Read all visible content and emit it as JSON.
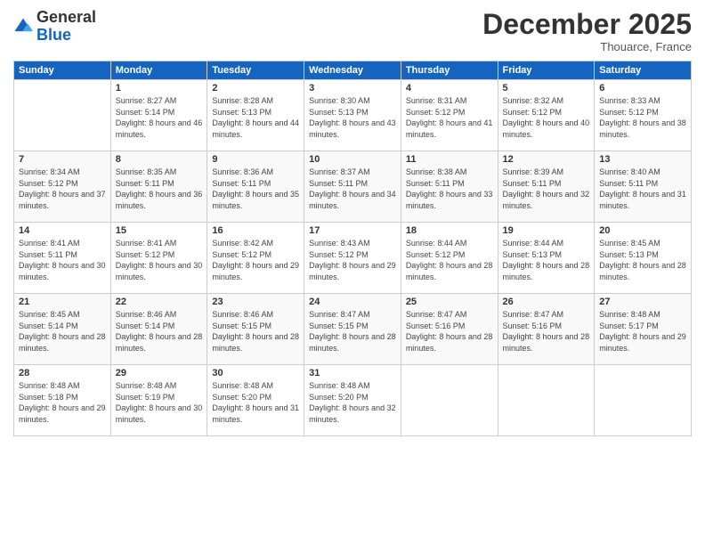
{
  "logo": {
    "general": "General",
    "blue": "Blue"
  },
  "header": {
    "month": "December 2025",
    "location": "Thouarce, France"
  },
  "weekdays": [
    "Sunday",
    "Monday",
    "Tuesday",
    "Wednesday",
    "Thursday",
    "Friday",
    "Saturday"
  ],
  "weeks": [
    [
      {
        "day": "",
        "sunrise": "",
        "sunset": "",
        "daylight": ""
      },
      {
        "day": "1",
        "sunrise": "Sunrise: 8:27 AM",
        "sunset": "Sunset: 5:14 PM",
        "daylight": "Daylight: 8 hours and 46 minutes."
      },
      {
        "day": "2",
        "sunrise": "Sunrise: 8:28 AM",
        "sunset": "Sunset: 5:13 PM",
        "daylight": "Daylight: 8 hours and 44 minutes."
      },
      {
        "day": "3",
        "sunrise": "Sunrise: 8:30 AM",
        "sunset": "Sunset: 5:13 PM",
        "daylight": "Daylight: 8 hours and 43 minutes."
      },
      {
        "day": "4",
        "sunrise": "Sunrise: 8:31 AM",
        "sunset": "Sunset: 5:12 PM",
        "daylight": "Daylight: 8 hours and 41 minutes."
      },
      {
        "day": "5",
        "sunrise": "Sunrise: 8:32 AM",
        "sunset": "Sunset: 5:12 PM",
        "daylight": "Daylight: 8 hours and 40 minutes."
      },
      {
        "day": "6",
        "sunrise": "Sunrise: 8:33 AM",
        "sunset": "Sunset: 5:12 PM",
        "daylight": "Daylight: 8 hours and 38 minutes."
      }
    ],
    [
      {
        "day": "7",
        "sunrise": "Sunrise: 8:34 AM",
        "sunset": "Sunset: 5:12 PM",
        "daylight": "Daylight: 8 hours and 37 minutes."
      },
      {
        "day": "8",
        "sunrise": "Sunrise: 8:35 AM",
        "sunset": "Sunset: 5:11 PM",
        "daylight": "Daylight: 8 hours and 36 minutes."
      },
      {
        "day": "9",
        "sunrise": "Sunrise: 8:36 AM",
        "sunset": "Sunset: 5:11 PM",
        "daylight": "Daylight: 8 hours and 35 minutes."
      },
      {
        "day": "10",
        "sunrise": "Sunrise: 8:37 AM",
        "sunset": "Sunset: 5:11 PM",
        "daylight": "Daylight: 8 hours and 34 minutes."
      },
      {
        "day": "11",
        "sunrise": "Sunrise: 8:38 AM",
        "sunset": "Sunset: 5:11 PM",
        "daylight": "Daylight: 8 hours and 33 minutes."
      },
      {
        "day": "12",
        "sunrise": "Sunrise: 8:39 AM",
        "sunset": "Sunset: 5:11 PM",
        "daylight": "Daylight: 8 hours and 32 minutes."
      },
      {
        "day": "13",
        "sunrise": "Sunrise: 8:40 AM",
        "sunset": "Sunset: 5:11 PM",
        "daylight": "Daylight: 8 hours and 31 minutes."
      }
    ],
    [
      {
        "day": "14",
        "sunrise": "Sunrise: 8:41 AM",
        "sunset": "Sunset: 5:11 PM",
        "daylight": "Daylight: 8 hours and 30 minutes."
      },
      {
        "day": "15",
        "sunrise": "Sunrise: 8:41 AM",
        "sunset": "Sunset: 5:12 PM",
        "daylight": "Daylight: 8 hours and 30 minutes."
      },
      {
        "day": "16",
        "sunrise": "Sunrise: 8:42 AM",
        "sunset": "Sunset: 5:12 PM",
        "daylight": "Daylight: 8 hours and 29 minutes."
      },
      {
        "day": "17",
        "sunrise": "Sunrise: 8:43 AM",
        "sunset": "Sunset: 5:12 PM",
        "daylight": "Daylight: 8 hours and 29 minutes."
      },
      {
        "day": "18",
        "sunrise": "Sunrise: 8:44 AM",
        "sunset": "Sunset: 5:12 PM",
        "daylight": "Daylight: 8 hours and 28 minutes."
      },
      {
        "day": "19",
        "sunrise": "Sunrise: 8:44 AM",
        "sunset": "Sunset: 5:13 PM",
        "daylight": "Daylight: 8 hours and 28 minutes."
      },
      {
        "day": "20",
        "sunrise": "Sunrise: 8:45 AM",
        "sunset": "Sunset: 5:13 PM",
        "daylight": "Daylight: 8 hours and 28 minutes."
      }
    ],
    [
      {
        "day": "21",
        "sunrise": "Sunrise: 8:45 AM",
        "sunset": "Sunset: 5:14 PM",
        "daylight": "Daylight: 8 hours and 28 minutes."
      },
      {
        "day": "22",
        "sunrise": "Sunrise: 8:46 AM",
        "sunset": "Sunset: 5:14 PM",
        "daylight": "Daylight: 8 hours and 28 minutes."
      },
      {
        "day": "23",
        "sunrise": "Sunrise: 8:46 AM",
        "sunset": "Sunset: 5:15 PM",
        "daylight": "Daylight: 8 hours and 28 minutes."
      },
      {
        "day": "24",
        "sunrise": "Sunrise: 8:47 AM",
        "sunset": "Sunset: 5:15 PM",
        "daylight": "Daylight: 8 hours and 28 minutes."
      },
      {
        "day": "25",
        "sunrise": "Sunrise: 8:47 AM",
        "sunset": "Sunset: 5:16 PM",
        "daylight": "Daylight: 8 hours and 28 minutes."
      },
      {
        "day": "26",
        "sunrise": "Sunrise: 8:47 AM",
        "sunset": "Sunset: 5:16 PM",
        "daylight": "Daylight: 8 hours and 28 minutes."
      },
      {
        "day": "27",
        "sunrise": "Sunrise: 8:48 AM",
        "sunset": "Sunset: 5:17 PM",
        "daylight": "Daylight: 8 hours and 29 minutes."
      }
    ],
    [
      {
        "day": "28",
        "sunrise": "Sunrise: 8:48 AM",
        "sunset": "Sunset: 5:18 PM",
        "daylight": "Daylight: 8 hours and 29 minutes."
      },
      {
        "day": "29",
        "sunrise": "Sunrise: 8:48 AM",
        "sunset": "Sunset: 5:19 PM",
        "daylight": "Daylight: 8 hours and 30 minutes."
      },
      {
        "day": "30",
        "sunrise": "Sunrise: 8:48 AM",
        "sunset": "Sunset: 5:20 PM",
        "daylight": "Daylight: 8 hours and 31 minutes."
      },
      {
        "day": "31",
        "sunrise": "Sunrise: 8:48 AM",
        "sunset": "Sunset: 5:20 PM",
        "daylight": "Daylight: 8 hours and 32 minutes."
      },
      {
        "day": "",
        "sunrise": "",
        "sunset": "",
        "daylight": ""
      },
      {
        "day": "",
        "sunrise": "",
        "sunset": "",
        "daylight": ""
      },
      {
        "day": "",
        "sunrise": "",
        "sunset": "",
        "daylight": ""
      }
    ]
  ]
}
